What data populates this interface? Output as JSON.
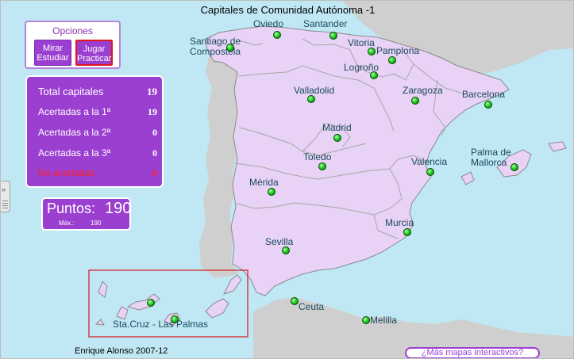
{
  "title": "Capitales de Comunidad Autónoma -1",
  "options": {
    "label": "Opciones",
    "mirar": [
      "Mirar",
      "Estudiar"
    ],
    "jugar": [
      "Jugar",
      "Practicar"
    ]
  },
  "score": {
    "total_label": "Total capitales",
    "total_value": "19",
    "first_label": "Acertadas a la 1ª",
    "first_value": "19",
    "second_label": "Acertadas a la 2ª",
    "second_value": "0",
    "third_label": "Acertadas a la 3ª",
    "third_value": "0",
    "wrong_label": "No acertadas",
    "wrong_value": "0"
  },
  "points": {
    "label": "Puntos:",
    "value": "190",
    "max_label": "Máx.:",
    "max_value": "190"
  },
  "capitals": {
    "santiago": "Santiago de\nCompostela",
    "oviedo": "Oviedo",
    "santander": "Santander",
    "vitoria": "Vitoria",
    "pamplona": "Pamplona",
    "logrono": "Logroño",
    "valladolid": "Valladolid",
    "zaragoza": "Zaragoza",
    "barcelona": "Barcelona",
    "madrid": "Madrid",
    "toledo": "Toledo",
    "palma": "Palma de\nMallorca",
    "valencia": "Valencia",
    "merida": "Mérida",
    "murcia": "Murcia",
    "sevilla": "Sevilla",
    "ceuta": "Ceuta",
    "melilla": "Melilla",
    "canarias": "Sta.Cruz - Las Palmas"
  },
  "footer": {
    "author": "Enrique Alonso 2007-12",
    "more_maps": "¿Más mapas interactivos?"
  },
  "colors": {
    "sea": "#bfe8f4",
    "land": "#e8d2f5",
    "panel": "#9b3fd1",
    "dot": "#20d020",
    "highlight": "#e01818"
  }
}
